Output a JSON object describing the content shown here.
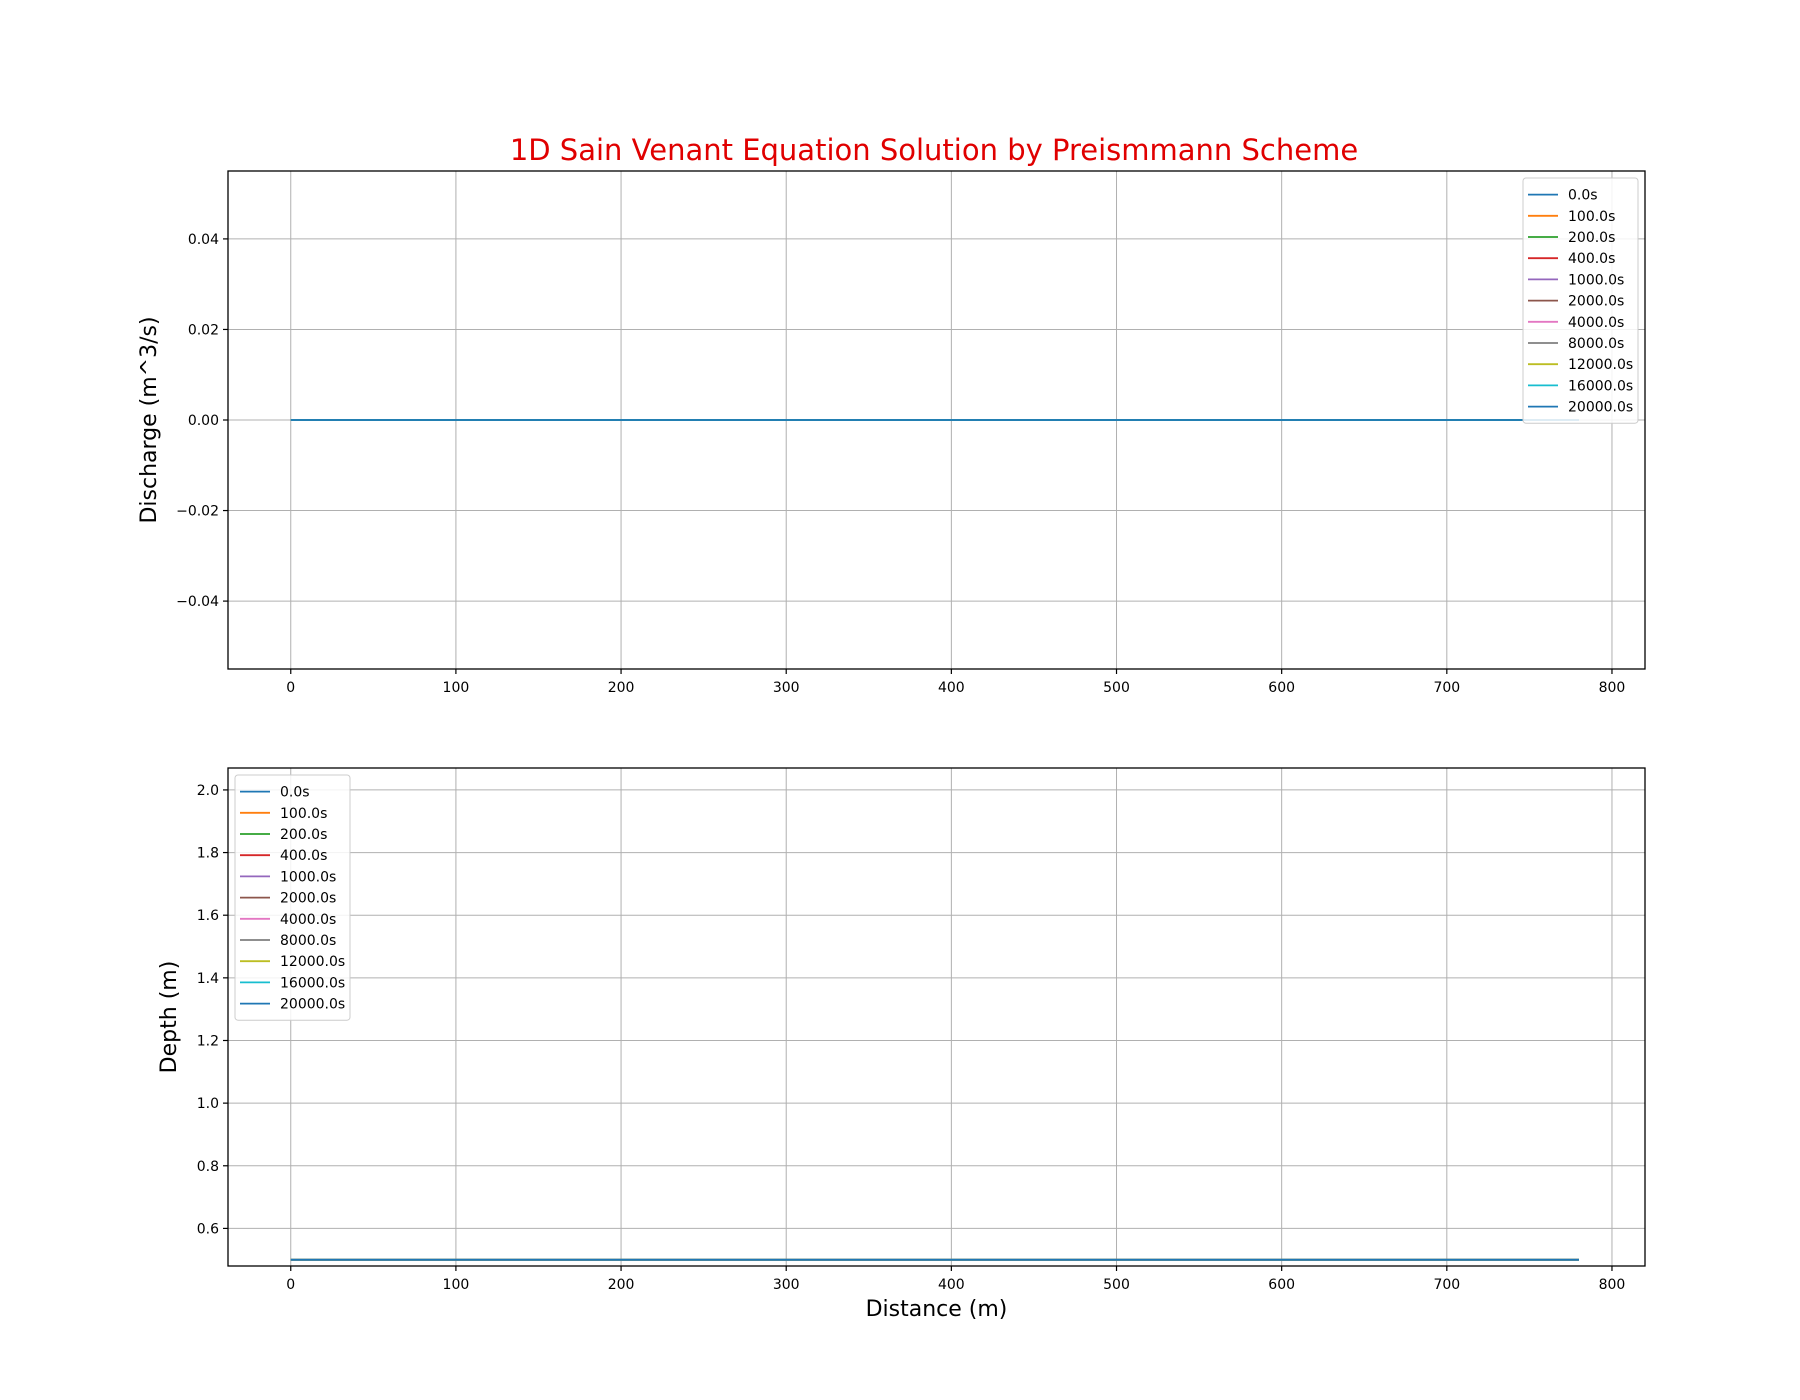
{
  "figure_title": "1D Sain Venant Equation Solution by Preismmann Scheme",
  "colors": {
    "title": "#e00000",
    "series": [
      "#1f77b4",
      "#ff7f0e",
      "#2ca02c",
      "#d62728",
      "#9467bd",
      "#8c564b",
      "#e377c2",
      "#7f7f7f",
      "#bcbd22",
      "#17becf",
      "#1f77b4"
    ]
  },
  "chart_data": [
    {
      "type": "line",
      "title": "1D Sain Venant Equation Solution by Preismmann Scheme",
      "xlabel": "",
      "ylabel": "Discharge (m^3/s)",
      "xlim": [
        -38,
        820
      ],
      "ylim": [
        -0.055,
        0.055
      ],
      "xticks": [
        0,
        100,
        200,
        300,
        400,
        500,
        600,
        700,
        800
      ],
      "xtick_labels": [
        "0",
        "100",
        "200",
        "300",
        "400",
        "500",
        "600",
        "700",
        "800"
      ],
      "yticks": [
        0.04,
        0.02,
        0.0,
        -0.02,
        -0.04
      ],
      "ytick_labels": [
        "0.04",
        "0.02",
        "0.00",
        "−0.02",
        "−0.04"
      ],
      "grid": true,
      "legend_position": "top-right",
      "series": [
        {
          "name": "0.0s",
          "x": [
            0,
            780
          ],
          "y": [
            0.0,
            0.0
          ]
        },
        {
          "name": "100.0s",
          "x": [
            0,
            780
          ],
          "y": [
            0.0,
            0.0
          ]
        },
        {
          "name": "200.0s",
          "x": [
            0,
            780
          ],
          "y": [
            0.0,
            0.0
          ]
        },
        {
          "name": "400.0s",
          "x": [
            0,
            780
          ],
          "y": [
            0.0,
            0.0
          ]
        },
        {
          "name": "1000.0s",
          "x": [
            0,
            780
          ],
          "y": [
            0.0,
            0.0
          ]
        },
        {
          "name": "2000.0s",
          "x": [
            0,
            780
          ],
          "y": [
            0.0,
            0.0
          ]
        },
        {
          "name": "4000.0s",
          "x": [
            0,
            780
          ],
          "y": [
            0.0,
            0.0
          ]
        },
        {
          "name": "8000.0s",
          "x": [
            0,
            780
          ],
          "y": [
            0.0,
            0.0
          ]
        },
        {
          "name": "12000.0s",
          "x": [
            0,
            780
          ],
          "y": [
            0.0,
            0.0
          ]
        },
        {
          "name": "16000.0s",
          "x": [
            0,
            780
          ],
          "y": [
            0.0,
            0.0
          ]
        },
        {
          "name": "20000.0s",
          "x": [
            0,
            780
          ],
          "y": [
            0.0,
            0.0
          ]
        }
      ]
    },
    {
      "type": "line",
      "title": "",
      "xlabel": "Distance (m)",
      "ylabel": "Depth (m)",
      "xlim": [
        -38,
        820
      ],
      "ylim": [
        0.48,
        2.07
      ],
      "xticks": [
        0,
        100,
        200,
        300,
        400,
        500,
        600,
        700,
        800
      ],
      "xtick_labels": [
        "0",
        "100",
        "200",
        "300",
        "400",
        "500",
        "600",
        "700",
        "800"
      ],
      "yticks": [
        2.0,
        1.8,
        1.6,
        1.4,
        1.2,
        1.0,
        0.8,
        0.6
      ],
      "ytick_labels": [
        "2.0",
        "1.8",
        "1.6",
        "1.4",
        "1.2",
        "1.0",
        "0.8",
        "0.6"
      ],
      "grid": true,
      "legend_position": "top-left",
      "series": [
        {
          "name": "0.0s",
          "x": [
            0,
            780
          ],
          "y": [
            0.5,
            0.5
          ]
        },
        {
          "name": "100.0s",
          "x": [
            0,
            780
          ],
          "y": [
            0.5,
            0.5
          ]
        },
        {
          "name": "200.0s",
          "x": [
            0,
            780
          ],
          "y": [
            0.5,
            0.5
          ]
        },
        {
          "name": "400.0s",
          "x": [
            0,
            780
          ],
          "y": [
            0.5,
            0.5
          ]
        },
        {
          "name": "1000.0s",
          "x": [
            0,
            780
          ],
          "y": [
            0.5,
            0.5
          ]
        },
        {
          "name": "2000.0s",
          "x": [
            0,
            780
          ],
          "y": [
            0.5,
            0.5
          ]
        },
        {
          "name": "4000.0s",
          "x": [
            0,
            780
          ],
          "y": [
            0.5,
            0.5
          ]
        },
        {
          "name": "8000.0s",
          "x": [
            0,
            780
          ],
          "y": [
            0.5,
            0.5
          ]
        },
        {
          "name": "12000.0s",
          "x": [
            0,
            780
          ],
          "y": [
            0.5,
            0.5
          ]
        },
        {
          "name": "16000.0s",
          "x": [
            0,
            780
          ],
          "y": [
            0.5,
            0.5
          ]
        },
        {
          "name": "20000.0s",
          "x": [
            0,
            780
          ],
          "y": [
            0.5,
            0.5
          ]
        }
      ]
    }
  ]
}
